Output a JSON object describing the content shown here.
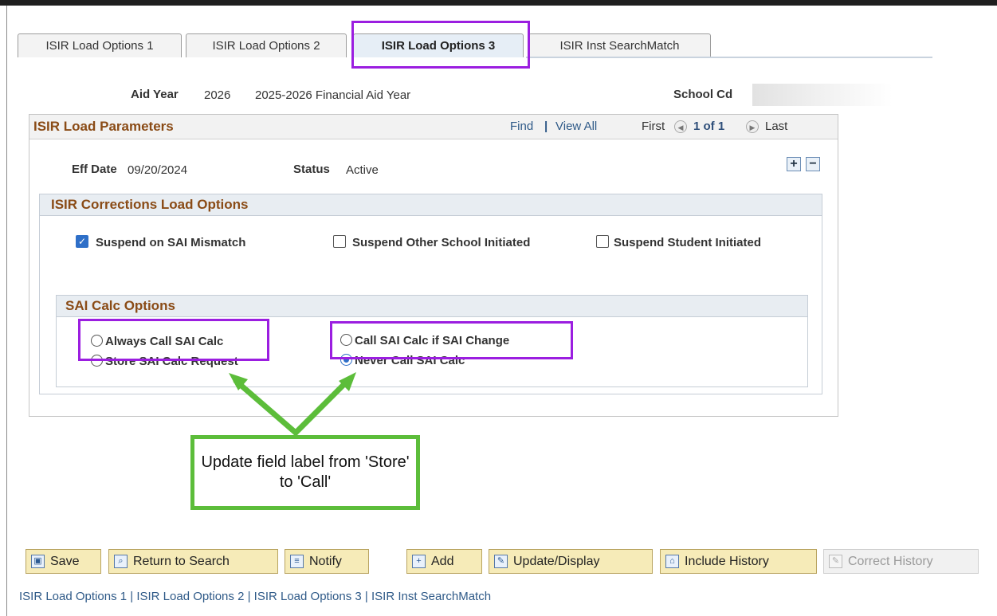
{
  "tabs": [
    {
      "label": "ISIR Load Options 1"
    },
    {
      "label": "ISIR Load Options 2"
    },
    {
      "label": "ISIR Load Options 3"
    },
    {
      "label": "ISIR Inst SearchMatch"
    }
  ],
  "header": {
    "aid_year_label": "Aid Year",
    "aid_year_value": "2026",
    "aid_year_desc": "2025-2026 Financial Aid Year",
    "school_cd_label": "School Cd"
  },
  "grid": {
    "title": "ISIR Load Parameters",
    "find": "Find",
    "separator": "|",
    "view_all": "View All",
    "first": "First",
    "position": "1 of 1",
    "last": "Last",
    "prev_icon": "◀",
    "next_icon": "▶",
    "add_row": "+",
    "delete_row": "−",
    "eff_date_label": "Eff Date",
    "eff_date_value": "09/20/2024",
    "status_label": "Status",
    "status_value": "Active"
  },
  "corrections": {
    "title": "ISIR Corrections Load Options",
    "suspend_sai_mismatch": "Suspend on SAI Mismatch",
    "suspend_other_school": "Suspend Other School Initiated",
    "suspend_student": "Suspend Student Initiated",
    "check_mark": "✓"
  },
  "sai_calc": {
    "title": "SAI Calc Options",
    "always_call": "Always Call SAI Calc",
    "call_if_change": "Call SAI Calc if SAI Change",
    "store_request": "Store SAI Calc Request",
    "never_call": "Never Call SAI Calc"
  },
  "annotation": {
    "note": "Update field label from 'Store' to 'Call'",
    "highlight_color": "#9b1ee0",
    "arrow_color": "#5cbd3a"
  },
  "buttons": {
    "save": "Save",
    "return_to_search": "Return to Search",
    "notify": "Notify",
    "add": "Add",
    "update_display": "Update/Display",
    "include_history": "Include History",
    "correct_history": "Correct History"
  },
  "footer": {
    "link1": "ISIR Load Options 1",
    "link2": "ISIR Load Options 2",
    "link3": "ISIR Load Options 3",
    "link4": "ISIR Inst SearchMatch",
    "sep": " | "
  }
}
